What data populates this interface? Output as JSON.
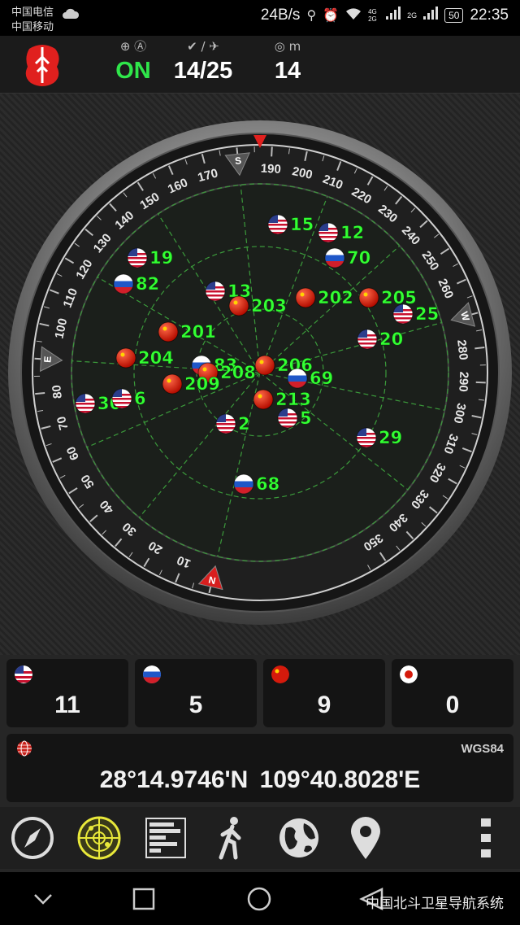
{
  "statusbar": {
    "carrier1": "中国电信",
    "carrier2": "中国移动",
    "net_speed": "24B/s",
    "net_type_a": "4G 2G",
    "net_type_b": "2G",
    "battery": "50",
    "time": "22:35"
  },
  "header": {
    "fix_icons": "⊕ Ⓐ",
    "fix_status": "ON",
    "sat_icons": "✔ / ✈",
    "sats_used": "14/25",
    "acc_icons": "◎ m",
    "accuracy": "14"
  },
  "compass": {
    "cardinals": [
      "S",
      "W",
      "N",
      "E"
    ],
    "degree_labels": [
      "10",
      "20",
      "30",
      "40",
      "50",
      "60",
      "70",
      "80",
      "100",
      "110",
      "120",
      "130",
      "140",
      "150",
      "160",
      "170",
      "190",
      "200",
      "210",
      "220",
      "230",
      "240",
      "250",
      "260",
      "280",
      "290",
      "300",
      "310",
      "320",
      "330",
      "340",
      "350"
    ]
  },
  "satellites": [
    {
      "id": "15",
      "system": "usa"
    },
    {
      "id": "12",
      "system": "usa"
    },
    {
      "id": "70",
      "system": "russia"
    },
    {
      "id": "19",
      "system": "usa"
    },
    {
      "id": "82",
      "system": "russia"
    },
    {
      "id": "13",
      "system": "usa"
    },
    {
      "id": "203",
      "system": "china"
    },
    {
      "id": "202",
      "system": "china"
    },
    {
      "id": "205",
      "system": "china"
    },
    {
      "id": "25",
      "system": "usa"
    },
    {
      "id": "201",
      "system": "china"
    },
    {
      "id": "20",
      "system": "usa"
    },
    {
      "id": "204",
      "system": "china"
    },
    {
      "id": "83",
      "system": "russia"
    },
    {
      "id": "206",
      "system": "china"
    },
    {
      "id": "208",
      "system": "china"
    },
    {
      "id": "69",
      "system": "russia"
    },
    {
      "id": "209",
      "system": "china"
    },
    {
      "id": "30",
      "system": "usa"
    },
    {
      "id": "6",
      "system": "usa"
    },
    {
      "id": "213",
      "system": "china"
    },
    {
      "id": "2",
      "system": "usa"
    },
    {
      "id": "5",
      "system": "usa"
    },
    {
      "id": "29",
      "system": "usa"
    },
    {
      "id": "68",
      "system": "russia"
    }
  ],
  "systems": [
    {
      "name": "usa",
      "count": "11"
    },
    {
      "name": "russia",
      "count": "5"
    },
    {
      "name": "china",
      "count": "9"
    },
    {
      "name": "japan",
      "count": "0"
    }
  ],
  "position": {
    "datum": "WGS84",
    "latitude": "28°14.9746'N",
    "longitude": "109°40.8028'E"
  },
  "toolbar": {
    "icons": [
      "compass-icon",
      "radar-icon",
      "signal-bars-icon",
      "walking-icon",
      "globe-icon",
      "location-pin-icon",
      "more-icon"
    ]
  },
  "watermark": "中国北斗卫星导航系统",
  "colors": {
    "green_label": "#33ff33",
    "fix_on": "#2fe64a",
    "radar_bg": "#1b1f1b"
  }
}
